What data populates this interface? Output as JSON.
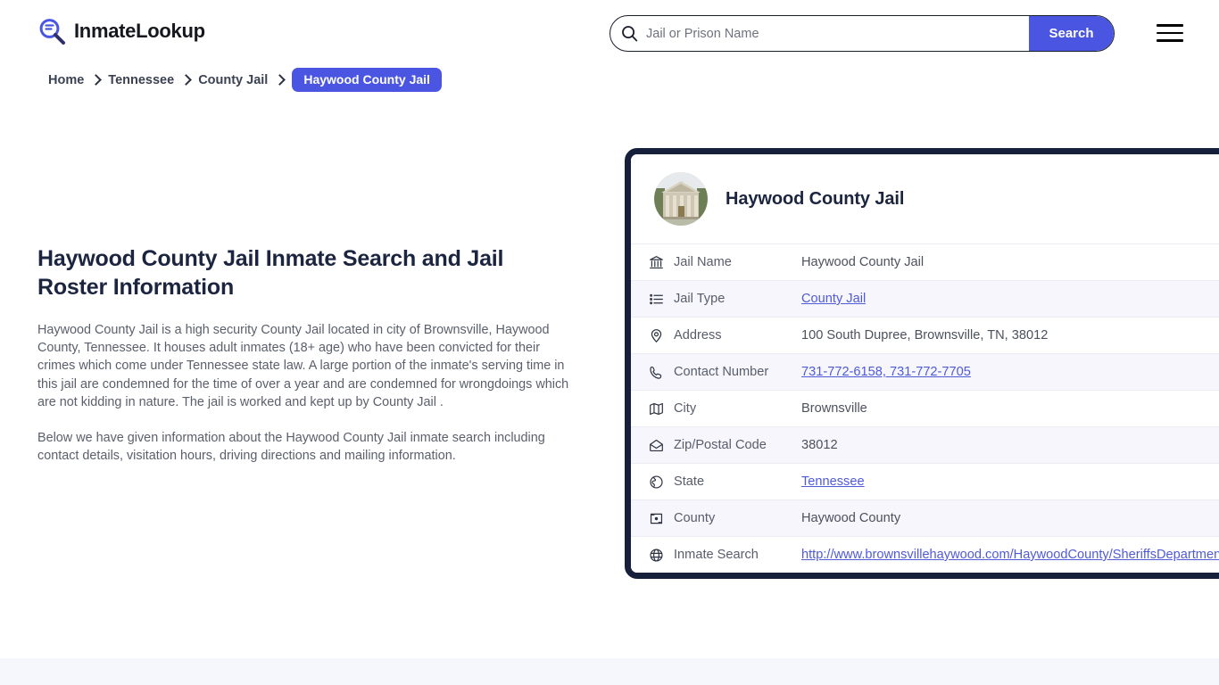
{
  "header": {
    "brand": "InmateLookup",
    "brand_icon": "magnifier-logo-icon",
    "search": {
      "placeholder": "Jail or Prison Name",
      "value": "",
      "icon": "search-icon",
      "button_label": "Search"
    },
    "menu_icon": "hamburger-menu-icon"
  },
  "breadcrumb": {
    "items": [
      {
        "label": "Home"
      },
      {
        "label": "Tennessee"
      },
      {
        "label": "County Jail"
      }
    ],
    "current": "Haywood County Jail"
  },
  "main": {
    "title": "Haywood County Jail Inmate Search and Jail Roster Information",
    "paragraphs": [
      "Haywood County Jail is a high security County Jail located in city of Brownsville, Haywood County, Tennessee. It houses adult inmates (18+ age) who have been convicted for their crimes which come under Tennessee state law. A large portion of the inmate's serving time in this jail are condemned for the time of over a year and are condemned for wrongdoings which are not kidding in nature. The jail is worked and kept up by County Jail .",
      "Below we have given information about the Haywood County Jail inmate search including contact details, visitation hours, driving directions and mailing information."
    ]
  },
  "card": {
    "avatar_icon": "courthouse-photo",
    "title": "Haywood County Jail",
    "rows": [
      {
        "icon": "bank-icon",
        "label": "Jail Name",
        "value": "Haywood County Jail",
        "link": false
      },
      {
        "icon": "list-icon",
        "label": "Jail Type",
        "value": "County Jail",
        "link": true
      },
      {
        "icon": "map-pin-icon",
        "label": "Address",
        "value": "100 South Dupree, Brownsville, TN, 38012",
        "link": false
      },
      {
        "icon": "phone-icon",
        "label": "Contact Number",
        "value": "731-772-6158, 731-772-7705",
        "link": true
      },
      {
        "icon": "map-icon",
        "label": "City",
        "value": "Brownsville",
        "link": false
      },
      {
        "icon": "envelope-icon",
        "label": "Zip/Postal Code",
        "value": "38012",
        "link": false
      },
      {
        "icon": "globe-americas-icon",
        "label": "State",
        "value": "Tennessee",
        "link": true
      },
      {
        "icon": "county-badge-icon",
        "label": "County",
        "value": "Haywood County",
        "link": false
      },
      {
        "icon": "globe-icon",
        "label": "Inmate Search",
        "value": "http://www.brownsvillehaywood.com/HaywoodCounty/SheriffsDepartment",
        "link": true
      }
    ]
  },
  "colors": {
    "accent": "#4a56e2",
    "link": "#4f5bd5",
    "card_border": "#17203a",
    "heading": "#1c2540",
    "row_alt": "#f6f6fc",
    "bottom_band": "#f6f6fd"
  }
}
